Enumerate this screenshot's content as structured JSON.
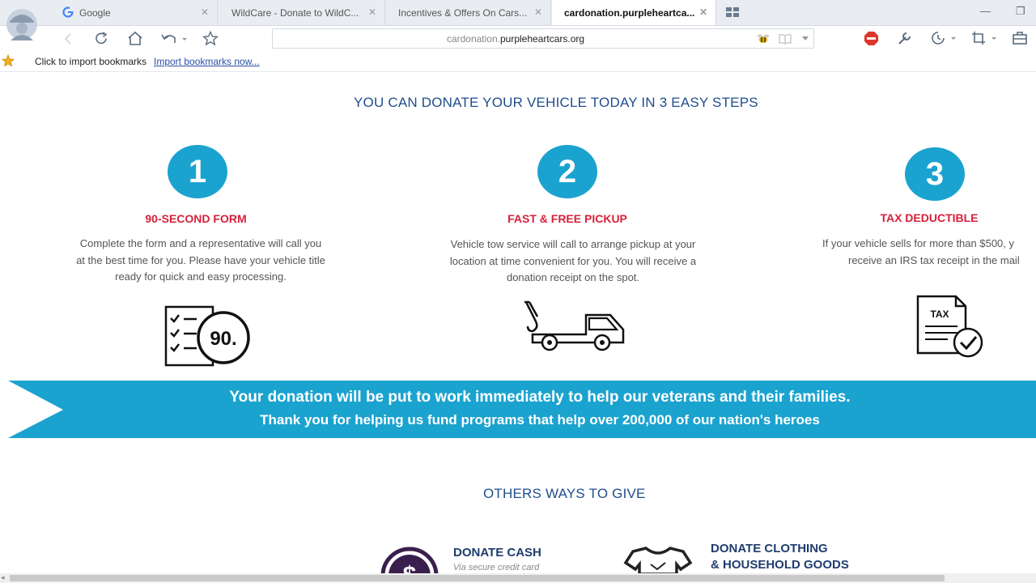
{
  "tabs": [
    {
      "label": "Google",
      "icon": "google-icon"
    },
    {
      "label": "WildCare - Donate to WildC..."
    },
    {
      "label": "Incentives & Offers On Cars..."
    },
    {
      "label": "cardonation.purpleheartca...",
      "active": true
    }
  ],
  "address": {
    "prefix": "cardonation.",
    "domain": "purpleheartcars.org"
  },
  "bookmarks": {
    "prompt": "Click to import bookmarks",
    "link": "Import bookmarks now..."
  },
  "page": {
    "heading": "YOU CAN DONATE YOUR VEHICLE TODAY IN 3 EASY STEPS",
    "steps": [
      {
        "number": "1",
        "title": "90-SECOND FORM",
        "desc": "Complete the form and a representative will call you at the best time for you.  Please have your vehicle title ready for quick and easy processing.",
        "icon": "checklist-90-icon",
        "badge": "90."
      },
      {
        "number": "2",
        "title": "FAST & FREE PICKUP",
        "desc": "Vehicle tow service will call to arrange pickup at your location at time convenient for you.  You will receive a donation receipt on the spot.",
        "icon": "tow-truck-icon"
      },
      {
        "number": "3",
        "title": "TAX DEDUCTIBLE",
        "desc": "If your vehicle sells for more than $500, y receive an IRS tax receipt in the mail",
        "icon": "tax-document-icon",
        "badge": "TAX"
      }
    ],
    "banner": {
      "line1": "Your donation will be put to work immediately to help our veterans and their families.",
      "line2": "Thank you for helping us fund programs that help over 200,000 of our nation's heroes"
    },
    "others_heading": "OTHERS WAYS TO GIVE",
    "give": [
      {
        "title": "DONATE CASH",
        "subtitle": "Via secure credit card",
        "icon": "dollar-coin-icon"
      },
      {
        "title_line1": "DONATE CLOTHING",
        "title_line2": "& HOUSEHOLD GOODS",
        "icon": "clothing-shirt-icon"
      }
    ]
  },
  "colors": {
    "accent": "#1ba3cf",
    "heading": "#1f4e8c",
    "step_title": "#d6213a"
  }
}
